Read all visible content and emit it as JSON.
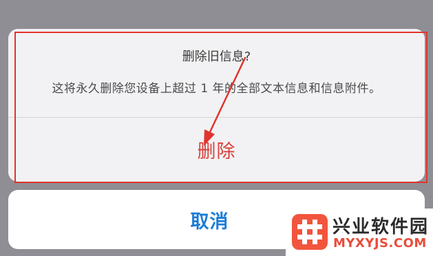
{
  "dialog": {
    "title": "删除旧信息?",
    "message": "这将永久删除您设备上超过 1 年的全部文本信息和信息附件。",
    "destructive_action_label": "删除"
  },
  "cancel_sheet": {
    "cancel_label": "取消"
  },
  "watermark": {
    "brand_name": "兴业软件园",
    "domain": "MYXYJS.COM",
    "logo_icon": "hash-icon"
  },
  "colors": {
    "destructive": "#d8403a",
    "cancel": "#1c7cd6",
    "annotation": "#e0342c",
    "watermark_accent": "#f2553d"
  }
}
